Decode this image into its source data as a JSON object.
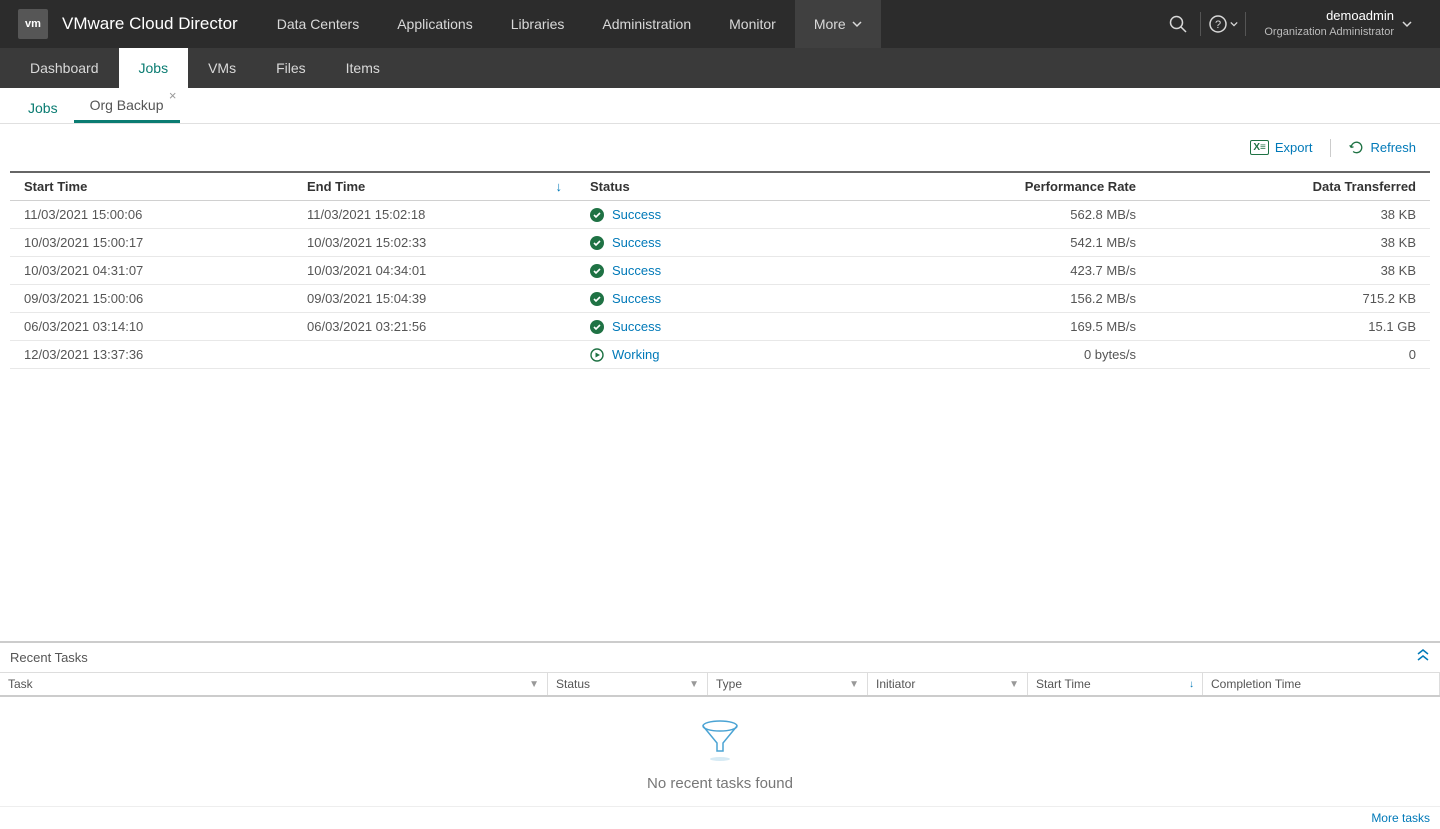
{
  "app": {
    "logo_text": "vm",
    "title": "VMware Cloud Director"
  },
  "primary_nav": [
    {
      "label": "Data Centers"
    },
    {
      "label": "Applications"
    },
    {
      "label": "Libraries"
    },
    {
      "label": "Administration"
    },
    {
      "label": "Monitor"
    },
    {
      "label": "More"
    }
  ],
  "user": {
    "name": "demoadmin",
    "role": "Organization Administrator"
  },
  "sub_nav": [
    {
      "label": "Dashboard"
    },
    {
      "label": "Jobs"
    },
    {
      "label": "VMs"
    },
    {
      "label": "Files"
    },
    {
      "label": "Items"
    }
  ],
  "tabs": [
    {
      "label": "Jobs",
      "active": false,
      "closable": false
    },
    {
      "label": "Org Backup",
      "active": true,
      "closable": true
    }
  ],
  "toolbar": {
    "export": "Export",
    "refresh": "Refresh"
  },
  "columns": {
    "start": "Start Time",
    "end": "End Time",
    "status": "Status",
    "perf": "Performance Rate",
    "data": "Data Transferred"
  },
  "rows": [
    {
      "start": "11/03/2021 15:00:06",
      "end": "11/03/2021 15:02:18",
      "status": "Success",
      "status_kind": "success",
      "perf": "562.8 MB/s",
      "data": "38 KB"
    },
    {
      "start": "10/03/2021 15:00:17",
      "end": "10/03/2021 15:02:33",
      "status": "Success",
      "status_kind": "success",
      "perf": "542.1 MB/s",
      "data": "38 KB"
    },
    {
      "start": "10/03/2021 04:31:07",
      "end": "10/03/2021 04:34:01",
      "status": "Success",
      "status_kind": "success",
      "perf": "423.7 MB/s",
      "data": "38 KB"
    },
    {
      "start": "09/03/2021 15:00:06",
      "end": "09/03/2021 15:04:39",
      "status": "Success",
      "status_kind": "success",
      "perf": "156.2 MB/s",
      "data": "715.2 KB"
    },
    {
      "start": "06/03/2021 03:14:10",
      "end": "06/03/2021 03:21:56",
      "status": "Success",
      "status_kind": "success",
      "perf": "169.5 MB/s",
      "data": "15.1 GB"
    },
    {
      "start": "12/03/2021 13:37:36",
      "end": "",
      "status": "Working",
      "status_kind": "working",
      "perf": "0 bytes/s",
      "data": "0"
    }
  ],
  "recent": {
    "title": "Recent Tasks",
    "columns": [
      "Task",
      "Status",
      "Type",
      "Initiator",
      "Start Time",
      "Completion Time"
    ],
    "empty_text": "No recent tasks found",
    "more": "More tasks"
  }
}
